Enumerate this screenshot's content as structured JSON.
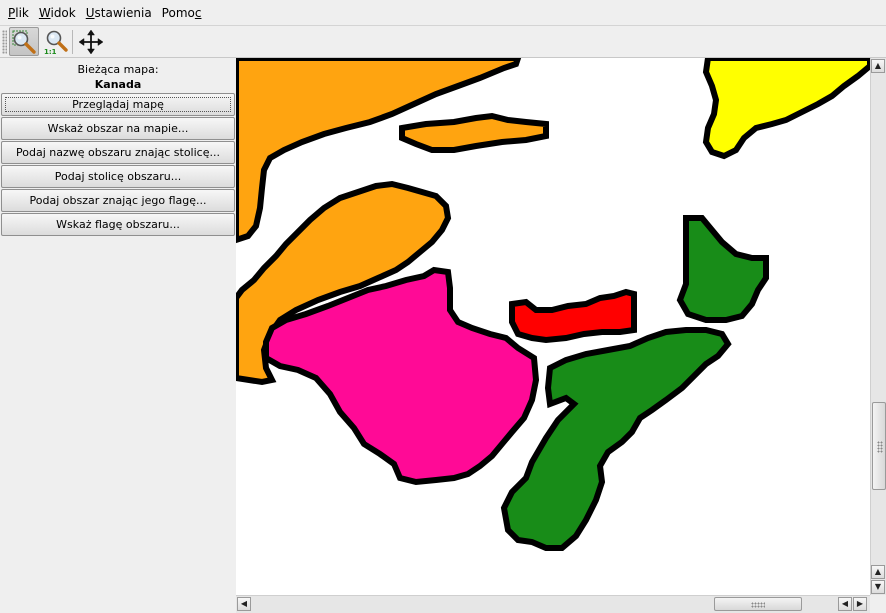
{
  "menubar": {
    "items": [
      {
        "label": "Plik",
        "mnemonic_index": 0
      },
      {
        "label": "Widok",
        "mnemonic_index": 0
      },
      {
        "label": "Ustawienia",
        "mnemonic_index": 0
      },
      {
        "label": "Pomoc",
        "mnemonic_index": 4
      }
    ]
  },
  "toolbar": {
    "tools": [
      {
        "icon": "zoom-area-icon",
        "active": true
      },
      {
        "icon": "zoom-original-icon",
        "active": false
      },
      {
        "icon": "move-icon",
        "active": false
      }
    ]
  },
  "sidebar": {
    "current_map_label": "Bieżąca mapa:",
    "current_map": "Kanada",
    "buttons": [
      {
        "label": "Przeglądaj mapę",
        "focused": true
      },
      {
        "label": "Wskaż obszar na mapie..."
      },
      {
        "label": "Podaj nazwę obszaru znając stolicę..."
      },
      {
        "label": "Podaj stolicę obszaru..."
      },
      {
        "label": "Podaj obszar znając jego flagę..."
      },
      {
        "label": "Wskaż flagę obszaru..."
      }
    ]
  },
  "map": {
    "colors": {
      "orange": "#ffa410",
      "yellow": "#ffff00",
      "pink": "#ff0a96",
      "red": "#ff0000",
      "green": "#188c18",
      "border": "#000000",
      "sea": "#ffffff"
    }
  },
  "scrollbars": {
    "vertical_position": 0.68,
    "horizontal_position": 0.81
  }
}
